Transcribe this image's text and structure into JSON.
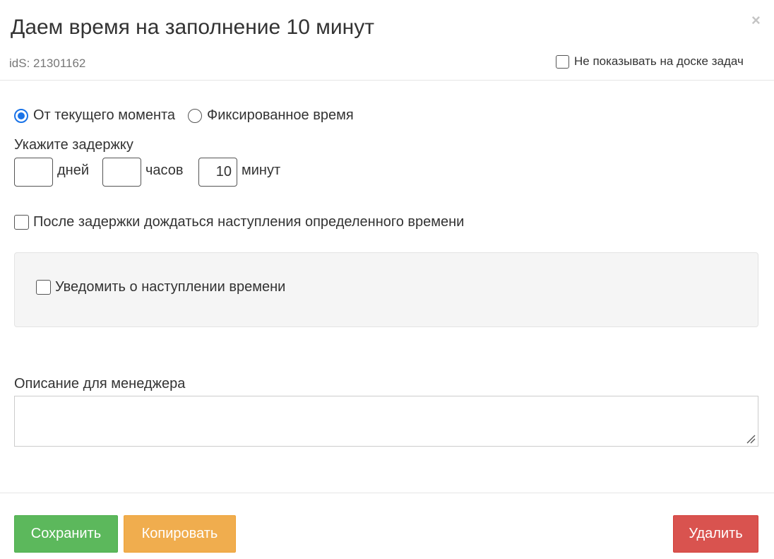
{
  "header": {
    "title": "Даем время на заполнение 10 минут",
    "close_glyph": "×",
    "ids": "idS: 21301162",
    "hide_label": "Не показывать на доске задач"
  },
  "timing": {
    "option_current": "От текущего момента",
    "option_fixed": "Фиксированное время",
    "selected": "От текущего момента"
  },
  "delay": {
    "label": "Укажите задержку",
    "days_value": "",
    "days_unit": "дней",
    "hours_value": "",
    "hours_unit": "часов",
    "minutes_value": "10",
    "minutes_unit": "минут"
  },
  "wait_label": "После задержки дождаться наступления определенного времени",
  "notify_label": "Уведомить о наступлении времени",
  "description": {
    "label": "Описание для менеджера",
    "value": ""
  },
  "footer": {
    "save_label": "Сохранить",
    "copy_label": "Копировать",
    "delete_label": "Удалить"
  },
  "colors": {
    "save": "#5cb85c",
    "copy": "#f0ad4e",
    "delete": "#d9534f",
    "radio_accent": "#1a73e8"
  }
}
